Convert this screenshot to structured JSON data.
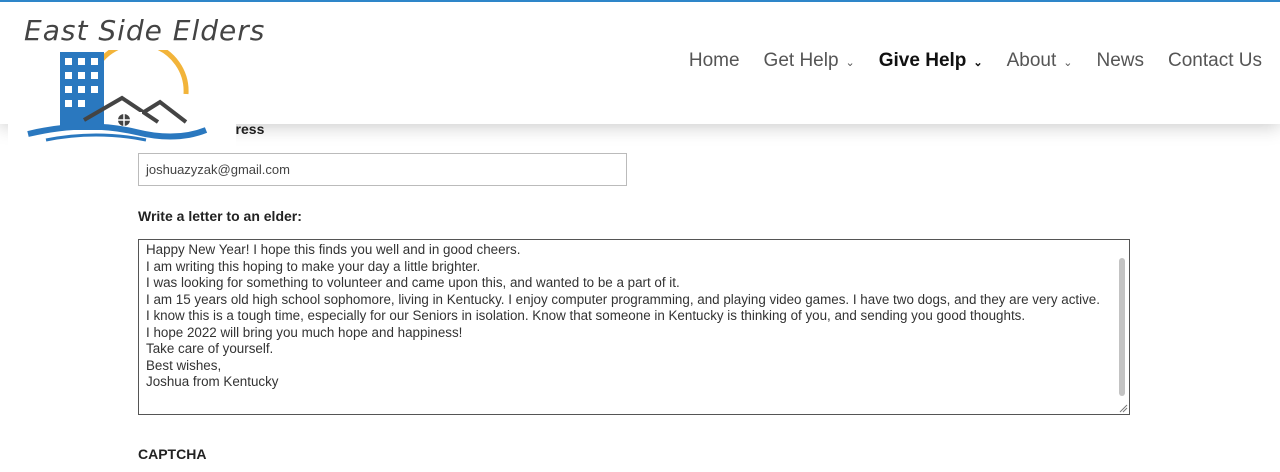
{
  "logo": {
    "text": "East Side Elders"
  },
  "nav": {
    "items": [
      {
        "label": "Home",
        "has_dropdown": false,
        "active": false
      },
      {
        "label": "Get Help",
        "has_dropdown": true,
        "active": false
      },
      {
        "label": "Give Help",
        "has_dropdown": true,
        "active": true
      },
      {
        "label": "About",
        "has_dropdown": true,
        "active": false
      },
      {
        "label": "News",
        "has_dropdown": false,
        "active": false
      },
      {
        "label": "Contact Us",
        "has_dropdown": false,
        "active": false
      }
    ],
    "dropdown_icon": "chevron-down-icon"
  },
  "form": {
    "email_label_visible": "dress",
    "email_value": "joshuazyzak@gmail.com",
    "letter_label": "Write a letter to an elder:",
    "letter_value": "Happy New Year! I hope this finds you well and in good cheers.\nI am writing this hoping to make your day a little brighter.\nI was looking for something to volunteer and came upon this, and wanted to be a part of it.\nI am 15 years old high school sophomore, living in Kentucky. I enjoy computer programming, and playing video games. I have two dogs, and they are very active.\nI know this is a tough time, especially for our Seniors in isolation. Know that someone in Kentucky is thinking of you, and sending you good thoughts.\nI hope 2022 will bring you much hope and happiness!\nTake care of yourself.\nBest wishes,\nJoshua from Kentucky",
    "captcha_label": "CAPTCHA"
  },
  "colors": {
    "accent_top_border": "#2e86c9",
    "logo_blue": "#2a78bf",
    "logo_sun": "#f2b43a",
    "logo_roof": "#444444"
  }
}
